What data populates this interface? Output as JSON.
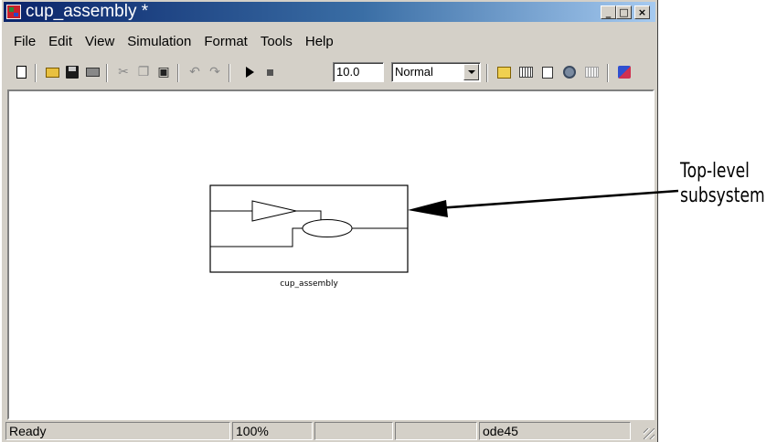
{
  "window": {
    "title": "cup_assembly *",
    "min_label": "_",
    "max_label": "□",
    "close_label": "×"
  },
  "menu": [
    "File",
    "Edit",
    "View",
    "Simulation",
    "Format",
    "Tools",
    "Help"
  ],
  "toolbar": {
    "stop_time": "10.0",
    "sim_mode": "Normal",
    "icons": [
      "new-model-icon",
      "open-icon",
      "save-icon",
      "print-icon",
      "cut-icon",
      "copy-icon",
      "paste-icon",
      "undo-icon",
      "redo-icon",
      "start-simulation-icon",
      "stop-simulation-icon",
      "library-browser-icon",
      "toggle-model-browser-icon",
      "update-diagram-icon",
      "build-icon",
      "debugger-icon"
    ]
  },
  "canvas": {
    "block_label": "cup_assembly"
  },
  "status": {
    "state": "Ready",
    "zoom": "100%",
    "solver": "ode45"
  },
  "annotation": {
    "line1": "Top-level",
    "line2": "subsystem"
  }
}
